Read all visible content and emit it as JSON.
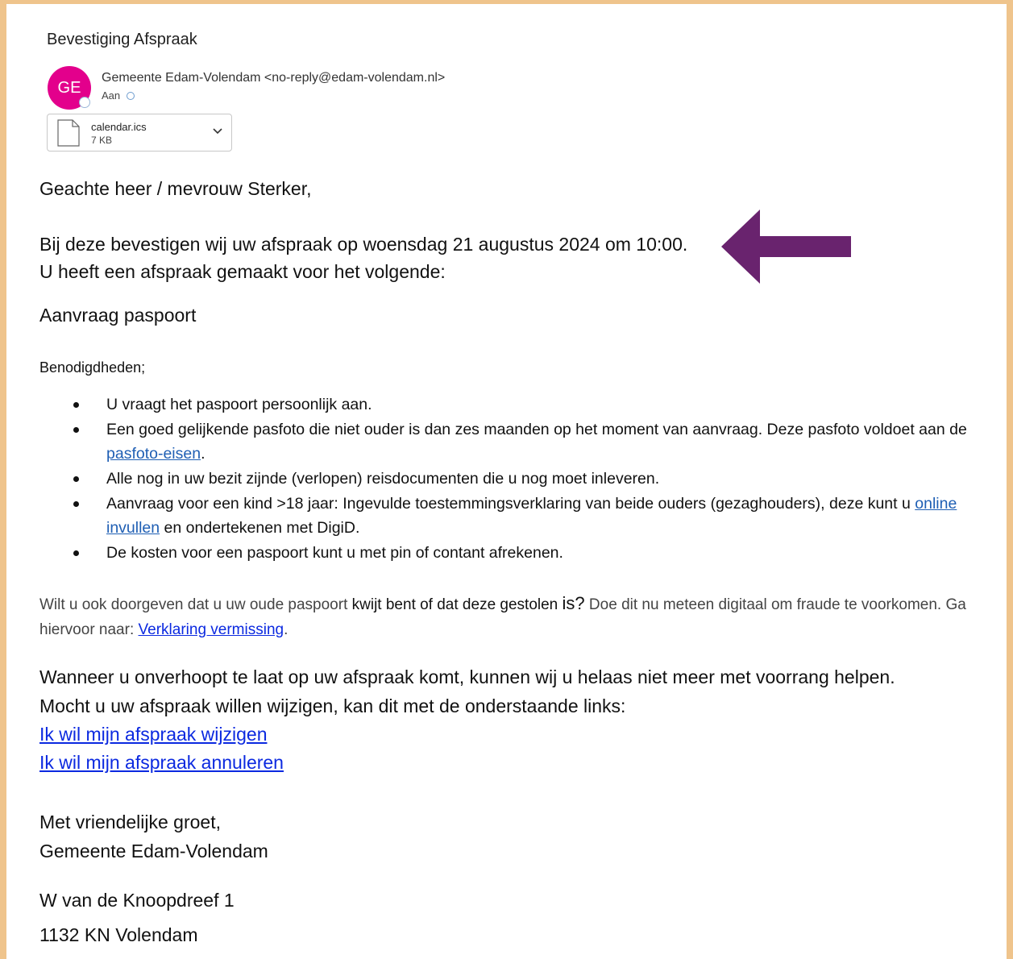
{
  "email": {
    "subject": "Bevestiging Afspraak",
    "avatar_initials": "GE",
    "avatar_color": "#e3008c",
    "sender": "Gemeente Edam-Volendam <no-reply@edam-volendam.nl>",
    "to_label": "Aan"
  },
  "attachment": {
    "name": "calendar.ics",
    "size": "7 KB"
  },
  "body": {
    "salutation": "Geachte heer / mevrouw Sterker,",
    "confirm_line1": "Bij deze bevestigen wij uw afspraak op woensdag 21 augustus 2024 om 10:00.",
    "confirm_line2": "U heeft een afspraak gemaakt voor het volgende:",
    "service": "Aanvraag paspoort",
    "needs_heading": "Benodigdheden;",
    "req1": "U vraagt het paspoort persoonlijk aan.",
    "req2_text": "Een goed gelijkende pasfoto die niet ouder is dan zes maanden op het moment van aanvraag. Deze pasfoto voldoet aan de ",
    "req2_link": "pasfoto-eisen",
    "req2_end": ".",
    "req3": "Alle nog in uw bezit zijnde (verlopen) reisdocumenten die u nog moet inleveren.",
    "req4_text": "Aanvraag voor een kind >18 jaar: Ingevulde toestemmingsverklaring van beide ouders (gezaghouders), deze kunt u ",
    "req4_link": "online invullen",
    "req4_end": " en ondertekenen met DigiD.",
    "req5": "De kosten voor een paspoort kunt u met pin of contant afrekenen.",
    "lost_part1": "Wilt u ook doorgeven dat u uw oude paspoort ",
    "lost_part2": "kwijt bent of dat deze gestolen ",
    "lost_part3": "is?",
    "lost_part4": " Doe dit nu meteen digitaal om fraude te voorkomen. Ga hiervoor naar: ",
    "lost_link": "Verklaring vermissing",
    "lost_end": ".",
    "late_line": "Wanneer u onverhoopt te laat op uw afspraak komt, kunnen wij u helaas niet meer met voorrang helpen.",
    "change_line": "Mocht u uw afspraak willen wijzigen, kan dit met de onderstaande links:",
    "link_change": "Ik wil mijn afspraak wijzigen",
    "link_cancel": "Ik wil mijn afspraak annuleren",
    "greeting": "Met vriendelijke groet,",
    "organisation": "Gemeente Edam-Volendam",
    "address1": "W van de Knoopdreef 1",
    "address2": "1132 KN Volendam"
  },
  "colors": {
    "frame_border": "#efc48c",
    "annotation_arrow": "#69236e",
    "link_blue": "#1f5fb4",
    "link_bright_blue": "#0b29e0"
  },
  "icons": {
    "annotation": "arrow-left-icon",
    "file": "file-icon",
    "dropdown": "chevron-down-icon"
  }
}
